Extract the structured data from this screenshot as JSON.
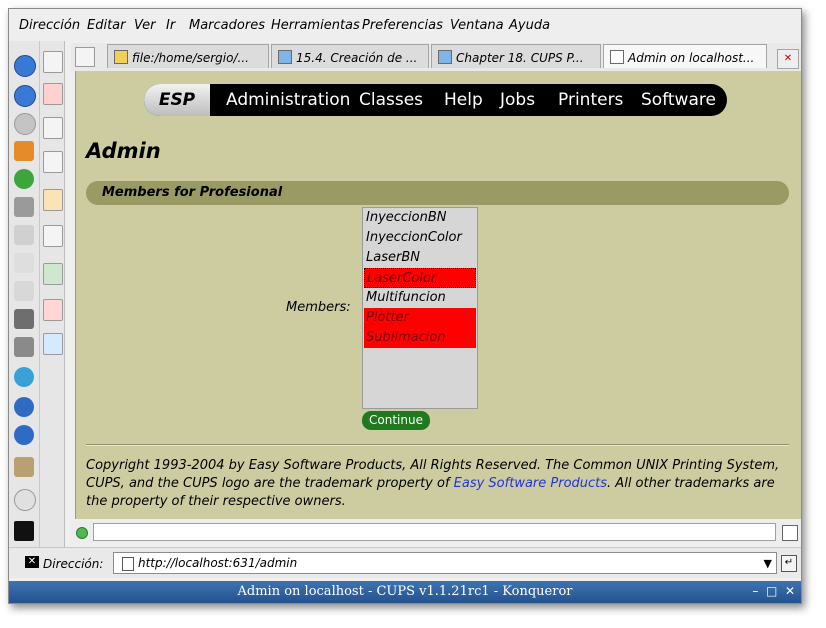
{
  "menubar": {
    "items": [
      "Dirección",
      "Editar",
      "Ver",
      "Ir",
      "Marcadores",
      "Herramientas",
      "Preferencias",
      "Ventana",
      "Ayuda"
    ]
  },
  "tabs": [
    {
      "label": "file:/home/sergio/...",
      "active": false
    },
    {
      "label": "15.4. Creación de ...",
      "active": false
    },
    {
      "label": "Chapter 18. CUPS P...",
      "active": false
    },
    {
      "label": "Admin on localhost...",
      "active": true
    }
  ],
  "nav": {
    "brand": "ESP",
    "links": [
      "Administration",
      "Classes",
      "Help",
      "Jobs",
      "Printers",
      "Software"
    ]
  },
  "page": {
    "title": "Admin",
    "group_header": "Members for Profesional",
    "members_label": "Members:",
    "options": [
      {
        "label": "InyeccionBN",
        "selected": false
      },
      {
        "label": "InyeccionColor",
        "selected": false
      },
      {
        "label": "LaserBN",
        "selected": false
      },
      {
        "label": "LaserColor",
        "selected": true
      },
      {
        "label": "Multifuncion",
        "selected": false
      },
      {
        "label": "Plotter",
        "selected": true
      },
      {
        "label": "Sublimacion",
        "selected": true
      }
    ],
    "continue_label": "Continue",
    "footer_pre": "Copyright 1993-2004 by Easy Software Products, All Rights Reserved. The Common UNIX Printing System, CUPS, and the CUPS logo are the trademark property of ",
    "footer_link": "Easy Software Products",
    "footer_post": ". All other trademarks are the property of their respective owners."
  },
  "location": {
    "label": "Dirección:",
    "url": "http://localhost:631/admin"
  },
  "window": {
    "title": "Admin on localhost - CUPS v1.1.21rc1 - Konqueror"
  },
  "colors": {
    "content_bg": "#cdcca0",
    "selected_option": "#ff0000",
    "continue_button": "#1f7a1f",
    "titlebar": "#2c5e9a"
  }
}
